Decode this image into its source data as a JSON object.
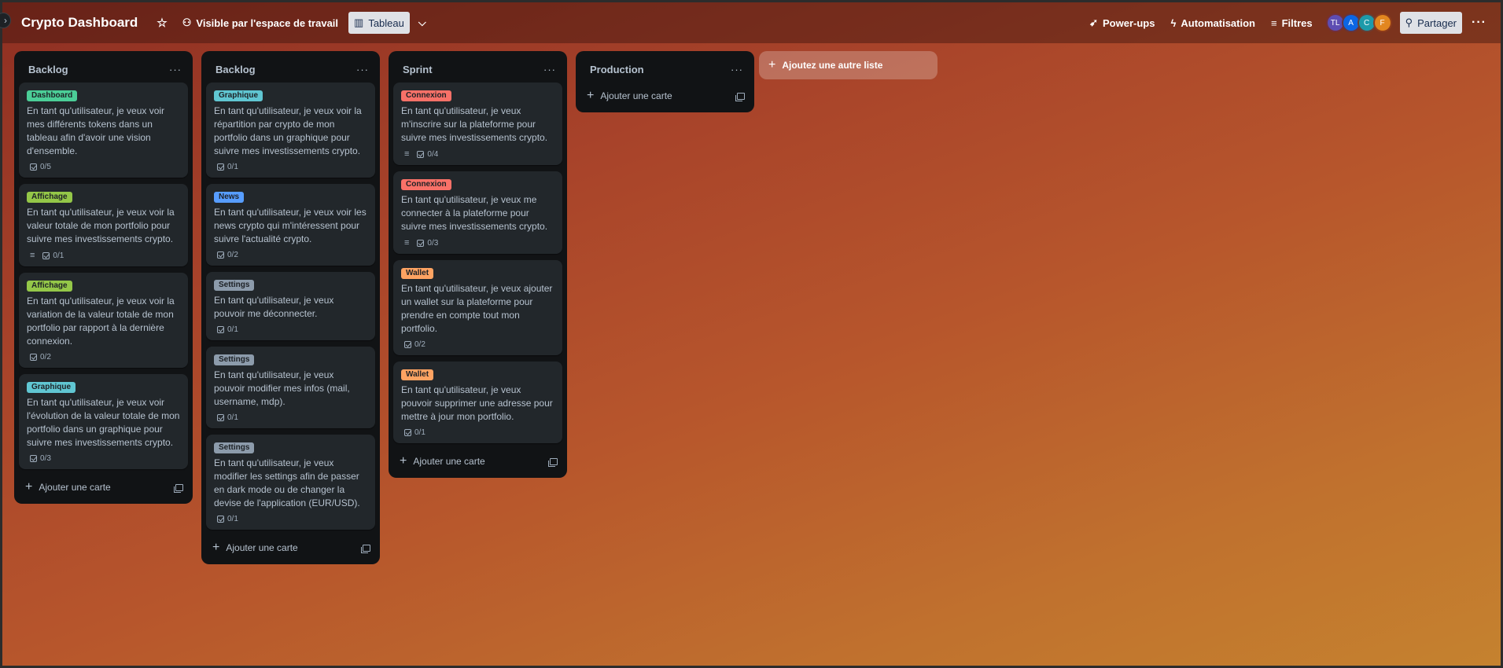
{
  "header": {
    "board_title": "Crypto Dashboard",
    "visibility": "Visible par l'espace de travail",
    "view": "Tableau",
    "powerups": "Power-ups",
    "automation": "Automatisation",
    "filters": "Filtres",
    "share": "Partager",
    "avatars": [
      {
        "initials": "TL",
        "color": "#5e4db2"
      },
      {
        "initials": "A",
        "color": "#0c66e4"
      },
      {
        "initials": "C",
        "color": "#1d9aaa"
      },
      {
        "initials": "F",
        "color": "#e2861f"
      }
    ]
  },
  "add_list_label": "Ajoutez une autre liste",
  "add_card_label": "Ajouter une carte",
  "lists": [
    {
      "title": "Backlog",
      "cards": [
        {
          "label": "Dashboard",
          "label_color": "green",
          "text": "En tant qu'utilisateur, je veux voir mes différents tokens dans un tableau afin d'avoir une vision d'ensemble.",
          "desc": false,
          "checklist": "0/5"
        },
        {
          "label": "Affichage",
          "label_color": "lime",
          "text": "En tant qu'utilisateur, je veux voir la valeur totale de mon portfolio pour suivre mes investissements crypto.",
          "desc": true,
          "checklist": "0/1"
        },
        {
          "label": "Affichage",
          "label_color": "lime",
          "text": "En tant qu'utilisateur, je veux voir la variation de la valeur totale de mon portfolio par rapport à la dernière connexion.",
          "desc": false,
          "checklist": "0/2"
        },
        {
          "label": "Graphique",
          "label_color": "teal",
          "text": "En tant qu'utilisateur, je veux voir l'évolution de la valeur totale de mon portfolio dans un graphique pour suivre mes investissements crypto.",
          "desc": false,
          "checklist": "0/3"
        }
      ]
    },
    {
      "title": "Backlog",
      "cards": [
        {
          "label": "Graphique",
          "label_color": "teal",
          "text": "En tant qu'utilisateur, je veux voir la répartition par crypto de mon portfolio dans un graphique pour suivre mes investissements crypto.",
          "desc": false,
          "checklist": "0/1"
        },
        {
          "label": "News",
          "label_color": "blue",
          "text": "En tant qu'utilisateur, je veux voir les news crypto qui m'intéressent pour suivre l'actualité crypto.",
          "desc": false,
          "checklist": "0/2"
        },
        {
          "label": "Settings",
          "label_color": "gray",
          "text": "En tant qu'utilisateur, je veux pouvoir me déconnecter.",
          "desc": false,
          "checklist": "0/1"
        },
        {
          "label": "Settings",
          "label_color": "gray",
          "text": "En tant qu'utilisateur, je veux pouvoir modifier mes infos (mail, username, mdp).",
          "desc": false,
          "checklist": "0/1"
        },
        {
          "label": "Settings",
          "label_color": "gray",
          "text": "En tant qu'utilisateur, je veux modifier les settings afin de passer en dark mode ou de changer la devise de l'application (EUR/USD).",
          "desc": false,
          "checklist": "0/1"
        }
      ]
    },
    {
      "title": "Sprint",
      "cards": [
        {
          "label": "Connexion",
          "label_color": "red",
          "text": "En tant qu'utilisateur, je veux m'inscrire sur la plateforme pour suivre mes investissements crypto.",
          "desc": true,
          "checklist": "0/4"
        },
        {
          "label": "Connexion",
          "label_color": "red",
          "text": "En tant qu'utilisateur, je veux me connecter à la plateforme pour suivre mes investissements crypto.",
          "desc": true,
          "checklist": "0/3"
        },
        {
          "label": "Wallet",
          "label_color": "orange",
          "text": "En tant qu'utilisateur, je veux ajouter un wallet sur la plateforme pour prendre en compte tout mon portfolio.",
          "desc": false,
          "checklist": "0/2"
        },
        {
          "label": "Wallet",
          "label_color": "orange",
          "text": "En tant qu'utilisateur, je veux pouvoir supprimer une adresse pour mettre à jour mon portfolio.",
          "desc": false,
          "checklist": "0/1"
        }
      ]
    },
    {
      "title": "Production",
      "cards": []
    }
  ]
}
